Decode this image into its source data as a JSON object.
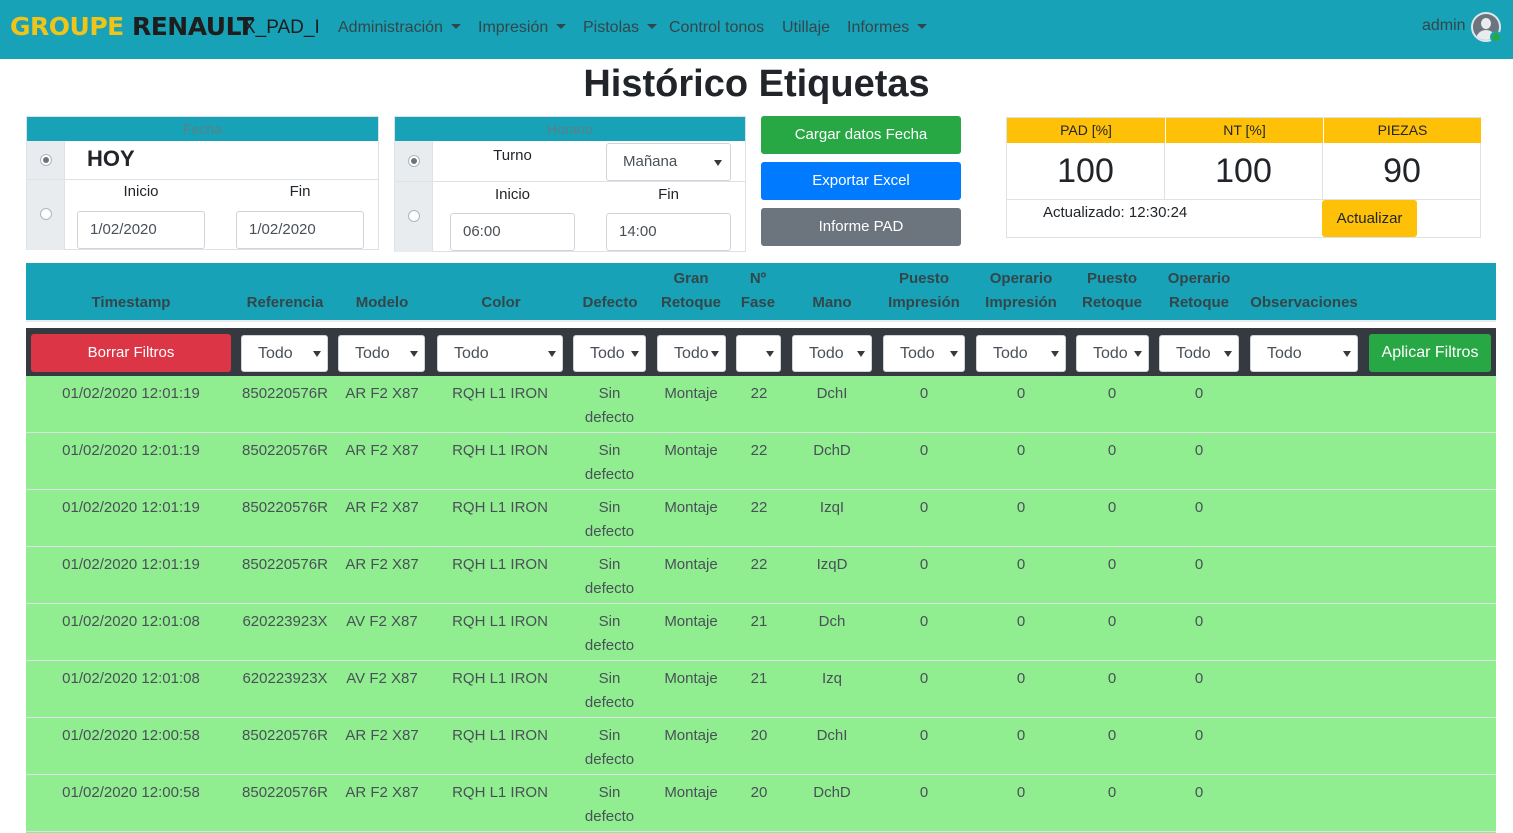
{
  "nav": {
    "brand_a": "GROUPE",
    "brand_b": "RENAULT",
    "app": "X_PAD_I",
    "menu": [
      {
        "label": "Administración",
        "dropdown": true
      },
      {
        "label": "Impresión",
        "dropdown": true
      },
      {
        "label": "Pistolas",
        "dropdown": true
      },
      {
        "label": "Control tonos",
        "dropdown": false
      },
      {
        "label": "Utillaje",
        "dropdown": false
      },
      {
        "label": "Informes",
        "dropdown": true
      }
    ],
    "user": "admin"
  },
  "title": "Histórico Etiquetas",
  "fecha": {
    "header": "Fecha",
    "hoy": "HOY",
    "inicio_label": "Inicio",
    "fin_label": "Fin",
    "inicio": "1/02/2020",
    "fin": "1/02/2020"
  },
  "horario": {
    "header": "Horario",
    "turno_label": "Turno",
    "turno": "Mañana",
    "inicio_label": "Inicio",
    "fin_label": "Fin",
    "inicio": "06:00",
    "fin": "14:00"
  },
  "actions": {
    "cargar": "Cargar datos Fecha",
    "exportar": "Exportar Excel",
    "informe": "Informe PAD"
  },
  "stats": {
    "pad_label": "PAD [%]",
    "nt_label": "NT [%]",
    "piezas_label": "PIEZAS",
    "pad": "100",
    "nt": "100",
    "piezas": "90",
    "updated": "Actualizado: 12:30:24",
    "refresh": "Actualizar"
  },
  "table": {
    "headers": {
      "timestamp": "Timestamp",
      "referencia": "Referencia",
      "modelo": "Modelo",
      "color": "Color",
      "defecto": "Defecto",
      "gran_retoque_1": "Gran",
      "gran_retoque_2": "Retoque",
      "fase_1": "Nº",
      "fase_2": "Fase",
      "mano": "Mano",
      "puesto_imp_1": "Puesto",
      "puesto_imp_2": "Impresión",
      "operario_imp_1": "Operario",
      "operario_imp_2": "Impresión",
      "puesto_ret_1": "Puesto",
      "puesto_ret_2": "Retoque",
      "operario_ret_1": "Operario",
      "operario_ret_2": "Retoque",
      "observaciones": "Observaciones"
    },
    "filters": {
      "clear": "Borrar Filtros",
      "apply": "Aplicar Filtros",
      "referencia": "Todo",
      "modelo": "Todo",
      "color": "Todo",
      "defecto": "Todo",
      "gran_retoque": "Todo",
      "fase": "",
      "mano": "Todo",
      "puesto_imp": "Todo",
      "operario_imp": "Todo",
      "puesto_ret": "Todo",
      "operario_ret": "Todo",
      "observaciones": "Todo"
    },
    "rows": [
      {
        "timestamp": "01/02/2020 12:01:19",
        "referencia": "850220576R",
        "modelo": "AR F2 X87",
        "color": "RQH L1 IRON",
        "defecto_1": "Sin",
        "defecto_2": "defecto",
        "gran_retoque": "Montaje",
        "fase": "22",
        "mano": "DchI",
        "puesto_imp": "0",
        "operario_imp": "0",
        "puesto_ret": "0",
        "operario_ret": "0"
      },
      {
        "timestamp": "01/02/2020 12:01:19",
        "referencia": "850220576R",
        "modelo": "AR F2 X87",
        "color": "RQH L1 IRON",
        "defecto_1": "Sin",
        "defecto_2": "defecto",
        "gran_retoque": "Montaje",
        "fase": "22",
        "mano": "DchD",
        "puesto_imp": "0",
        "operario_imp": "0",
        "puesto_ret": "0",
        "operario_ret": "0"
      },
      {
        "timestamp": "01/02/2020 12:01:19",
        "referencia": "850220576R",
        "modelo": "AR F2 X87",
        "color": "RQH L1 IRON",
        "defecto_1": "Sin",
        "defecto_2": "defecto",
        "gran_retoque": "Montaje",
        "fase": "22",
        "mano": "IzqI",
        "puesto_imp": "0",
        "operario_imp": "0",
        "puesto_ret": "0",
        "operario_ret": "0"
      },
      {
        "timestamp": "01/02/2020 12:01:19",
        "referencia": "850220576R",
        "modelo": "AR F2 X87",
        "color": "RQH L1 IRON",
        "defecto_1": "Sin",
        "defecto_2": "defecto",
        "gran_retoque": "Montaje",
        "fase": "22",
        "mano": "IzqD",
        "puesto_imp": "0",
        "operario_imp": "0",
        "puesto_ret": "0",
        "operario_ret": "0"
      },
      {
        "timestamp": "01/02/2020 12:01:08",
        "referencia": "620223923X",
        "modelo": "AV F2 X87",
        "color": "RQH L1 IRON",
        "defecto_1": "Sin",
        "defecto_2": "defecto",
        "gran_retoque": "Montaje",
        "fase": "21",
        "mano": "Dch",
        "puesto_imp": "0",
        "operario_imp": "0",
        "puesto_ret": "0",
        "operario_ret": "0"
      },
      {
        "timestamp": "01/02/2020 12:01:08",
        "referencia": "620223923X",
        "modelo": "AV F2 X87",
        "color": "RQH L1 IRON",
        "defecto_1": "Sin",
        "defecto_2": "defecto",
        "gran_retoque": "Montaje",
        "fase": "21",
        "mano": "Izq",
        "puesto_imp": "0",
        "operario_imp": "0",
        "puesto_ret": "0",
        "operario_ret": "0"
      },
      {
        "timestamp": "01/02/2020 12:00:58",
        "referencia": "850220576R",
        "modelo": "AR F2 X87",
        "color": "RQH L1 IRON",
        "defecto_1": "Sin",
        "defecto_2": "defecto",
        "gran_retoque": "Montaje",
        "fase": "20",
        "mano": "DchI",
        "puesto_imp": "0",
        "operario_imp": "0",
        "puesto_ret": "0",
        "operario_ret": "0"
      },
      {
        "timestamp": "01/02/2020 12:00:58",
        "referencia": "850220576R",
        "modelo": "AR F2 X87",
        "color": "RQH L1 IRON",
        "defecto_1": "Sin",
        "defecto_2": "defecto",
        "gran_retoque": "Montaje",
        "fase": "20",
        "mano": "DchD",
        "puesto_imp": "0",
        "operario_imp": "0",
        "puesto_ret": "0",
        "operario_ret": "0"
      }
    ]
  },
  "colors": {
    "navbar": "#17a2b8",
    "row_bg": "#90ee90",
    "filter_bar": "#343a40",
    "accent_yellow": "#ffc107",
    "success": "#28a745",
    "danger": "#dc3545",
    "primary": "#007bff"
  }
}
